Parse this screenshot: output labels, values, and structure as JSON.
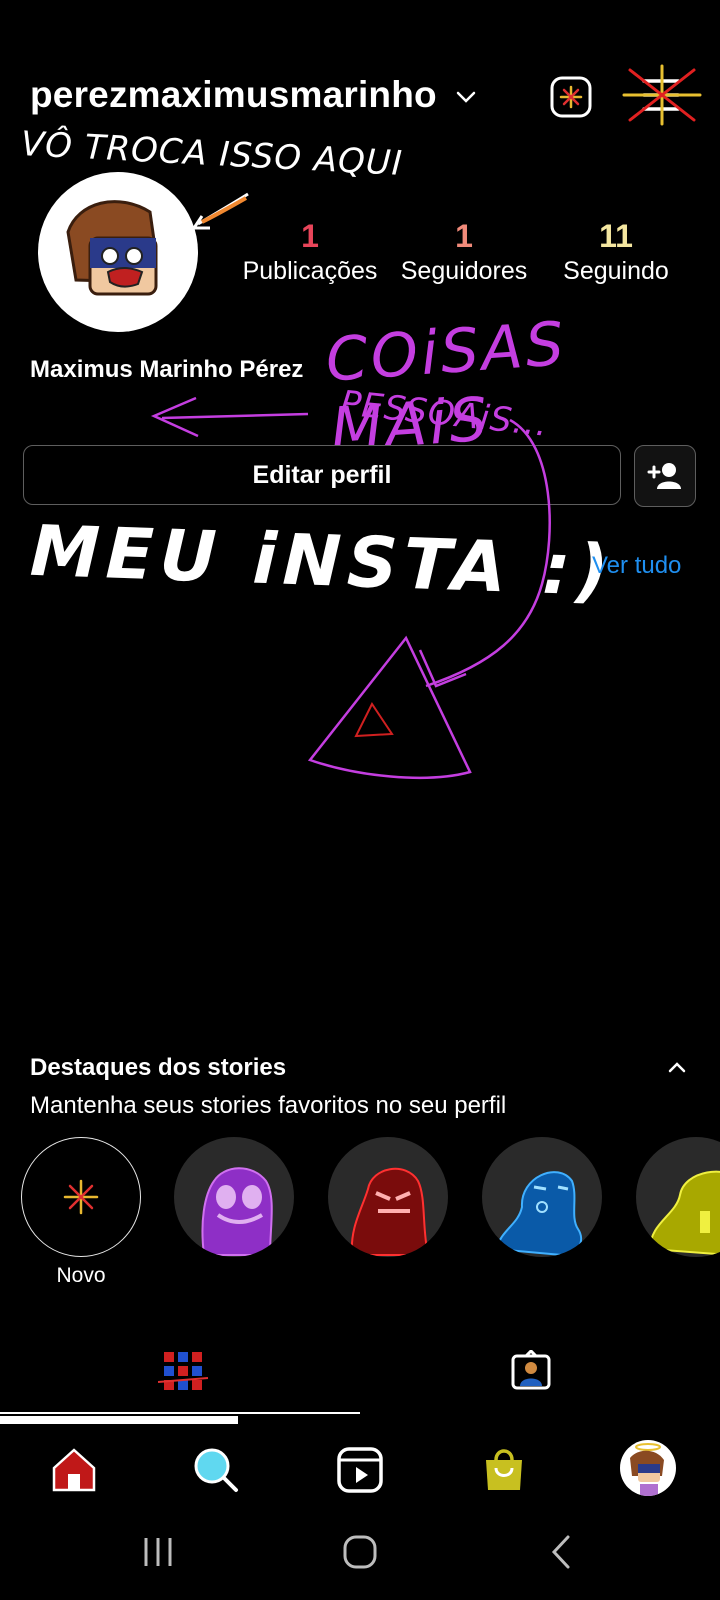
{
  "header": {
    "username": "perezmaximusmarinho"
  },
  "annotations": {
    "troca": "VÔ TROCA ISSO AQUI",
    "coisas": "COiSAS MAiS",
    "pessoais": "PESSOAiS...",
    "meu_insta": "MEU iNSTA :)"
  },
  "profile": {
    "full_name": "Maximus Marinho Pérez",
    "stats": [
      {
        "value": "1",
        "label": "Publicações",
        "color": "#e8455a"
      },
      {
        "value": "1",
        "label": "Seguidores",
        "color": "#f08a7a"
      },
      {
        "value": "11",
        "label": "Seguindo",
        "color": "#f4e6a0"
      }
    ]
  },
  "buttons": {
    "edit_profile": "Editar perfil",
    "ver_tudo": "Ver tudo"
  },
  "highlights": {
    "title": "Destaques dos stories",
    "subtitle": "Mantenha seus stories favoritos no seu perfil",
    "new_label": "Novo",
    "items": [
      {
        "color": "#8e2fc6",
        "name": "purple-character"
      },
      {
        "color": "#b01818",
        "name": "red-character"
      },
      {
        "color": "#1a7fd0",
        "name": "blue-character"
      },
      {
        "color": "#c8c81a",
        "name": "yellow-character"
      }
    ]
  },
  "tabs": {
    "active": "grid",
    "progress": 0.33
  },
  "nav": [
    "home",
    "search",
    "reels",
    "shop",
    "profile"
  ],
  "colors": {
    "accent_link": "#1f8ff0",
    "annotation_purple": "#c43ee0"
  }
}
